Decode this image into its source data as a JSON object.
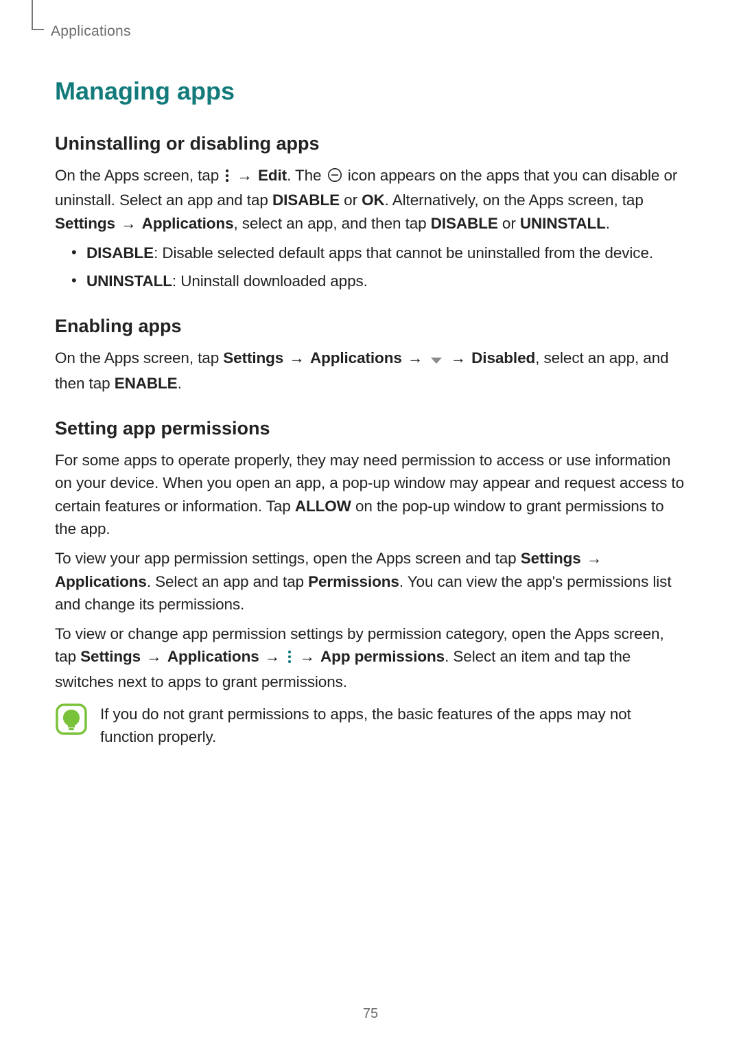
{
  "header": {
    "breadcrumb": "Applications"
  },
  "title": "Managing apps",
  "s1": {
    "heading": "Uninstalling or disabling apps",
    "p1a": "On the Apps screen, tap ",
    "p1b": " → ",
    "p1c": "Edit",
    "p1d": ". The ",
    "p1e": " icon appears on the apps that you can disable or uninstall. Select an app and tap ",
    "p1f": "DISABLE",
    "p1g": " or ",
    "p1h": "OK",
    "p1i": ". Alternatively, on the Apps screen, tap ",
    "p1j": "Settings",
    "p1k": " → ",
    "p1l": "Applications",
    "p1m": ", select an app, and then tap ",
    "p1n": "DISABLE",
    "p1o": " or ",
    "p1p": "UNINSTALL",
    "p1q": ".",
    "b1a": "DISABLE",
    "b1b": ": Disable selected default apps that cannot be uninstalled from the device.",
    "b2a": "UNINSTALL",
    "b2b": ": Uninstall downloaded apps."
  },
  "s2": {
    "heading": "Enabling apps",
    "p1a": "On the Apps screen, tap ",
    "p1b": "Settings",
    "p1c": " → ",
    "p1d": "Applications",
    "p1e": " → ",
    "p1f": " → ",
    "p1g": "Disabled",
    "p1h": ", select an app, and then tap ",
    "p1i": "ENABLE",
    "p1j": "."
  },
  "s3": {
    "heading": "Setting app permissions",
    "p1": "For some apps to operate properly, they may need permission to access or use information on your device. When you open an app, a pop-up window may appear and request access to certain features or information. Tap ",
    "p1b": "ALLOW",
    "p1c": " on the pop-up window to grant permissions to the app.",
    "p2a": "To view your app permission settings, open the Apps screen and tap ",
    "p2b": "Settings",
    "p2c": " → ",
    "p2d": "Applications",
    "p2e": ". Select an app and tap ",
    "p2f": "Permissions",
    "p2g": ". You can view the app's permissions list and change its permissions.",
    "p3a": "To view or change app permission settings by permission category, open the Apps screen, tap ",
    "p3b": "Settings",
    "p3c": " → ",
    "p3d": "Applications",
    "p3e": " → ",
    "p3f": " → ",
    "p3g": "App permissions",
    "p3h": ". Select an item and tap the switches next to apps to grant permissions.",
    "note": "If you do not grant permissions to apps, the basic features of the apps may not function properly."
  },
  "page_number": "75"
}
